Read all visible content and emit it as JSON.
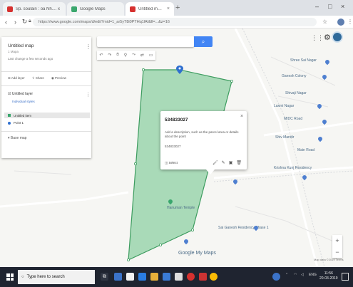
{
  "browser": {
    "tabs": [
      {
        "title": "Sp. soulain : oa Nh.... x",
        "color": "#d6312f",
        "active": false
      },
      {
        "title": "Google Maps",
        "color": "#3aa76d",
        "active": false
      },
      {
        "title": "Untitled map - Google My Maps",
        "color": "#d6312f",
        "active": true
      }
    ],
    "url": "https://www.google.com/maps/d/edit?mid=1_ar5yT8i0PTHq1lAf&ll=...&z=16",
    "window_controls": [
      "–",
      "□",
      "×"
    ]
  },
  "map": {
    "panel": {
      "title": "Untitled map",
      "subtitle": "1 Mapa",
      "description": "Last change a few seconds ago",
      "actions": [
        "Add layer",
        "Share",
        "Preview"
      ],
      "layer_name": "Untitled layer",
      "layer_link": "Individual styles",
      "items": [
        "Untitled item",
        "Point 1"
      ],
      "basemap": "Base map"
    },
    "search": {
      "placeholder": ""
    },
    "popup": {
      "title": "534833027",
      "text": "Add a description, such as the parcel area or details about the point",
      "code": "534833027",
      "footer_label": "Select"
    },
    "places": [
      "Shree Sai Nagar",
      "Ganesh Colony",
      "Shivaji Nagar",
      "Laxmi Nagar",
      "MIDC Road",
      "Shiv Mandir",
      "Main Road",
      "Krishna Kunj Residency",
      "Hanuman Temple",
      "Sai Ganesh Residency Phase 1"
    ],
    "brand": "Google My Maps",
    "copyright": "Map data ©2019 Terms"
  },
  "taskbar": {
    "search_placeholder": "Type here to search",
    "clock_time": "11:56",
    "clock_date": "20-03-2019",
    "lang": "ENG"
  },
  "colors": {
    "polygon_fill": "#8fd0a4",
    "polygon_stroke": "#3d9c5f",
    "accent": "#4285f4",
    "taskbar": "#1f2430"
  }
}
